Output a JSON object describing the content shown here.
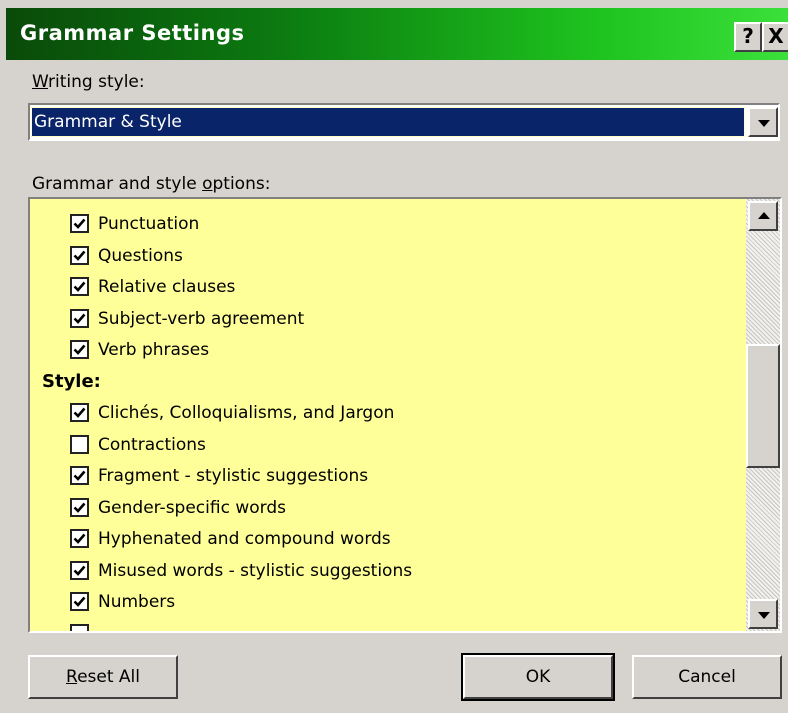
{
  "window": {
    "title": "Grammar Settings",
    "help_label": "?",
    "close_label": "X"
  },
  "writing_style": {
    "label_first": "W",
    "label_rest": "riting style:",
    "selected": "Grammar & Style"
  },
  "options": {
    "label_first": "Grammar and style ",
    "label_underlined": "o",
    "label_rest": "ptions:",
    "items": [
      {
        "type": "check",
        "label": "Punctuation",
        "checked": true
      },
      {
        "type": "check",
        "label": "Questions",
        "checked": true
      },
      {
        "type": "check",
        "label": "Relative clauses",
        "checked": true
      },
      {
        "type": "check",
        "label": "Subject-verb agreement",
        "checked": true
      },
      {
        "type": "check",
        "label": "Verb phrases",
        "checked": true
      },
      {
        "type": "section",
        "label": "Style:"
      },
      {
        "type": "check",
        "label": "Clichés, Colloquialisms, and Jargon",
        "checked": true
      },
      {
        "type": "check",
        "label": "Contractions",
        "checked": false
      },
      {
        "type": "check",
        "label": "Fragment - stylistic suggestions",
        "checked": true
      },
      {
        "type": "check",
        "label": "Gender-specific words",
        "checked": true
      },
      {
        "type": "check",
        "label": "Hyphenated and compound words",
        "checked": true
      },
      {
        "type": "check",
        "label": "Misused words - stylistic suggestions",
        "checked": true
      },
      {
        "type": "check",
        "label": "Numbers",
        "checked": true
      }
    ]
  },
  "buttons": {
    "reset_first": "R",
    "reset_rest": "eset All",
    "ok": "OK",
    "cancel": "Cancel"
  },
  "colors": {
    "title_gradient_start": "#0a4a0a",
    "title_gradient_end": "#3be03b",
    "list_background": "#ffff99",
    "selection": "#0a246a",
    "dialog_face": "#d6d3ce"
  }
}
